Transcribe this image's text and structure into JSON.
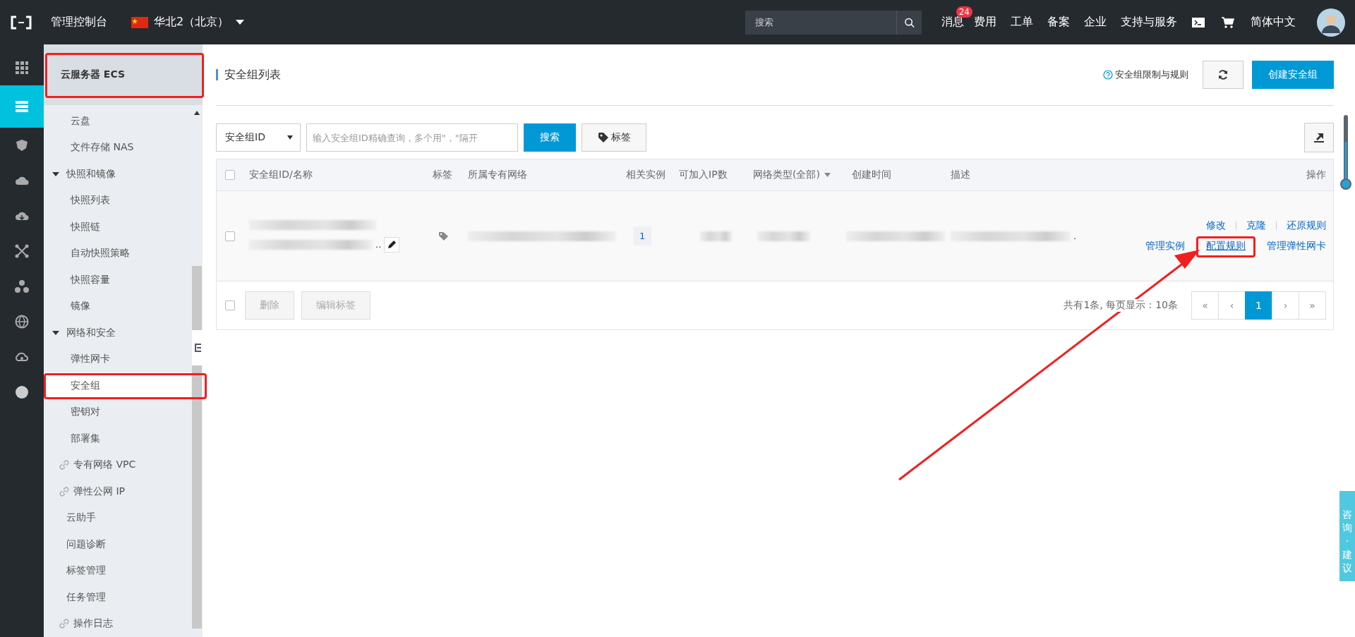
{
  "topbar": {
    "console": "管理控制台",
    "region": "华北2（北京）",
    "search": {
      "placeholder": "搜索"
    },
    "nav": [
      {
        "label": "消息",
        "badge": "24"
      },
      {
        "label": "费用"
      },
      {
        "label": "工单"
      },
      {
        "label": "备案"
      },
      {
        "label": "企业"
      },
      {
        "label": "支持与服务"
      }
    ],
    "language": "简体中文"
  },
  "rail": [
    {
      "selected": false
    },
    {
      "selected": true
    },
    {
      "selected": false
    },
    {
      "selected": false
    },
    {
      "selected": false
    },
    {
      "selected": false
    },
    {
      "selected": false
    },
    {
      "selected": false
    },
    {
      "selected": false
    },
    {
      "selected": false
    }
  ],
  "sidebar": {
    "title": "云服务器 ECS",
    "title_highlighted": true,
    "items": [
      {
        "label": "云盘",
        "kind": "sub",
        "selected": false,
        "highlighted": false
      },
      {
        "label": "文件存储 NAS",
        "kind": "sub",
        "selected": false,
        "highlighted": false
      },
      {
        "label": "快照和镜像",
        "kind": "group",
        "expanded": true,
        "children": [
          {
            "label": "快照列表",
            "kind": "sub",
            "selected": false,
            "highlighted": false
          },
          {
            "label": "快照链",
            "kind": "sub",
            "selected": false,
            "highlighted": false
          },
          {
            "label": "自动快照策略",
            "kind": "sub",
            "selected": false,
            "highlighted": false
          },
          {
            "label": "快照容量",
            "kind": "sub",
            "selected": false,
            "highlighted": false
          },
          {
            "label": "镜像",
            "kind": "sub",
            "selected": false,
            "highlighted": false
          }
        ]
      },
      {
        "label": "网络和安全",
        "kind": "group",
        "expanded": true,
        "children": [
          {
            "label": "弹性网卡",
            "kind": "sub",
            "selected": false,
            "highlighted": false
          },
          {
            "label": "安全组",
            "kind": "sub",
            "selected": true,
            "highlighted": true
          },
          {
            "label": "密钥对",
            "kind": "sub",
            "selected": false,
            "highlighted": false
          },
          {
            "label": "部署集",
            "kind": "sub",
            "selected": false,
            "highlighted": false
          }
        ]
      },
      {
        "label": "专有网络 VPC",
        "kind": "link",
        "selected": false,
        "highlighted": false
      },
      {
        "label": "弹性公网 IP",
        "kind": "link",
        "selected": false,
        "highlighted": false
      },
      {
        "label": "云助手",
        "kind": "item",
        "selected": false,
        "highlighted": false
      },
      {
        "label": "问题诊断",
        "kind": "item",
        "selected": false,
        "highlighted": false
      },
      {
        "label": "标签管理",
        "kind": "item",
        "selected": false,
        "highlighted": false
      },
      {
        "label": "任务管理",
        "kind": "item",
        "selected": false,
        "highlighted": false
      },
      {
        "label": "操作日志",
        "kind": "link",
        "selected": false,
        "highlighted": false
      }
    ]
  },
  "page": {
    "title": "安全组列表",
    "help_link": "安全组限制与规则",
    "create_button": "创建安全组"
  },
  "filter": {
    "field_select": "安全组ID",
    "query": {
      "placeholder": "输入安全组ID精确查询，多个用\"，\"隔开"
    },
    "search_button": "搜索",
    "tag_button": "标签"
  },
  "table": {
    "columns": [
      "安全组ID/名称",
      "标签",
      "所属专有网络",
      "相关实例",
      "可加入IP数",
      "网络类型(全部)",
      "创建时间",
      "描述",
      "操作"
    ],
    "select_all_checked": false,
    "rows": [
      {
        "checked": false,
        "name_trail": "..",
        "instances": "1",
        "description_trail": ".",
        "actions": [
          [
            {
              "label": "修改",
              "highlighted": false
            },
            {
              "label": "克隆",
              "highlighted": false
            },
            {
              "label": "还原规则",
              "highlighted": false
            }
          ],
          [
            {
              "label": "管理实例",
              "highlighted": false
            },
            {
              "label": "配置规则",
              "highlighted": true
            },
            {
              "label": "管理弹性网卡",
              "highlighted": false
            }
          ]
        ]
      }
    ],
    "footer": {
      "checked": false,
      "buttons": [
        {
          "label": "删除",
          "disabled": true
        },
        {
          "label": "编辑标签",
          "disabled": true
        }
      ],
      "summary": "共有1条, 每页显示：10条",
      "pages": [
        {
          "label": "«",
          "selected": false
        },
        {
          "label": "‹",
          "selected": false
        },
        {
          "label": "1",
          "selected": true
        },
        {
          "label": "›",
          "selected": false
        },
        {
          "label": "»",
          "selected": false
        }
      ]
    }
  },
  "feedback_tab": "咨询·建议",
  "annotation_arrow": true
}
